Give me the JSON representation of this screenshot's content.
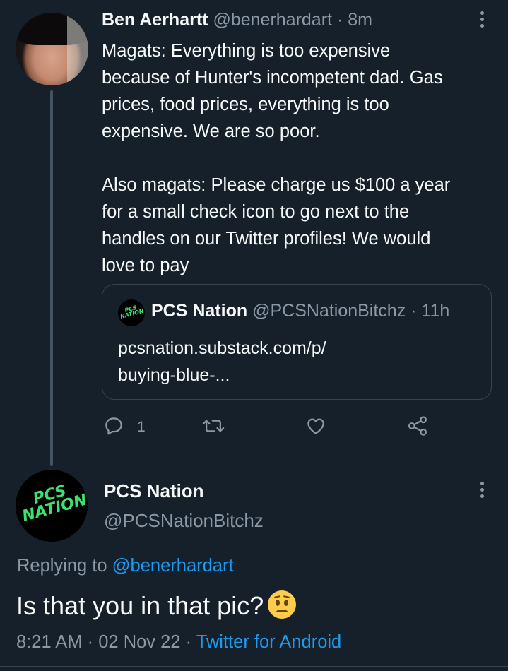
{
  "colors": {
    "background": "#15202b",
    "text": "#f7f9f9",
    "muted": "#8b98a5",
    "link": "#1d9bf0",
    "thread_line": "#425462",
    "pcs_green": "#39e36f"
  },
  "tweet1": {
    "name": "Ben Aerhartt",
    "handle": "@benerhardart",
    "separator": "·",
    "time": "8m",
    "text": "Magats: Everything is too expensive\nbecause of Hunter's incompetent dad. Gas\nprices, food prices, everything is too\nexpensive. We are so poor.\n\nAlso magats: Please charge us $100 a year\nfor a small check icon to go next to the\nhandles on our Twitter profiles! We would\nlove to pay",
    "quote": {
      "avatar_text": "PCS NATION",
      "name": "PCS Nation",
      "handle": "@PCSNationBitchz",
      "separator": "·",
      "time": "11h",
      "link_line1": "pcsnation.substack.com/p/",
      "link_line2": "buying-blue-..."
    },
    "actions": {
      "reply_icon": "reply-icon",
      "reply_count": "1",
      "retweet_icon": "retweet-icon",
      "like_icon": "heart-icon",
      "share_icon": "share-icon"
    }
  },
  "tweet2": {
    "avatar_text_line1": "PCS",
    "avatar_text_line2": "NATION",
    "name": "PCS Nation",
    "handle": "@PCSNationBitchz",
    "replying_prefix": "Replying to",
    "replying_handle": "@benerhardart",
    "text": "Is that you in that pic?",
    "emoji": "worried-face",
    "time": "8:21 AM",
    "separator": "·",
    "date": "02 Nov 22",
    "separator2": "·",
    "source": "Twitter for Android"
  }
}
